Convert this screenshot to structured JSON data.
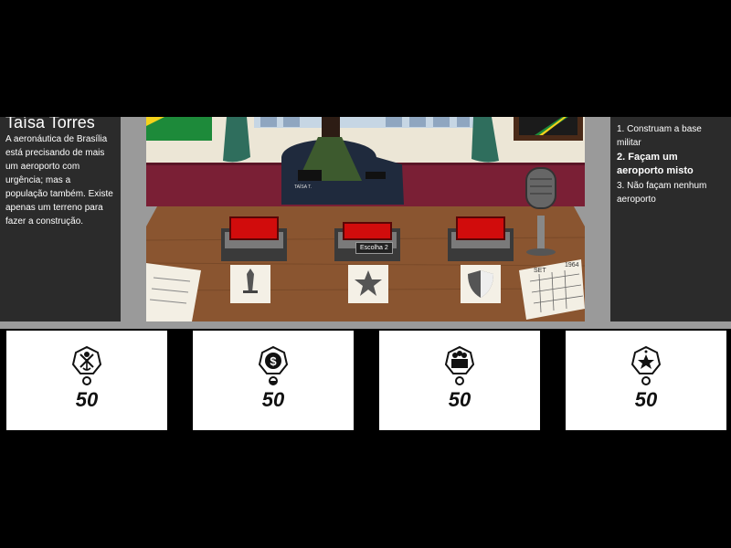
{
  "character": {
    "name": "Taísa Torres",
    "description": "A aeronáutica de Brasília está precisando de mais um aeroporto com urgência; mas a população também. Existe apenas um terreno para fazer a construção."
  },
  "choices": [
    {
      "label": "1. Construam a base militar",
      "selected": false
    },
    {
      "label": "2. Façam um aeroporto misto",
      "selected": true
    },
    {
      "label": "3. Não façam nenhum aeroporto",
      "selected": false
    }
  ],
  "scene": {
    "tooltip": "Escolha 2",
    "uniform_name": "TAÍSA T.",
    "calendar_header": "SET",
    "calendar_year": "1964",
    "button_color": "#d10c0c"
  },
  "resources": [
    {
      "icon": "military-emblem-icon",
      "value": "50",
      "indicator": "empty"
    },
    {
      "icon": "money-emblem-icon",
      "value": "50",
      "indicator": "half"
    },
    {
      "icon": "people-emblem-icon",
      "value": "50",
      "indicator": "empty"
    },
    {
      "icon": "star-emblem-icon",
      "value": "50",
      "indicator": "empty"
    }
  ]
}
